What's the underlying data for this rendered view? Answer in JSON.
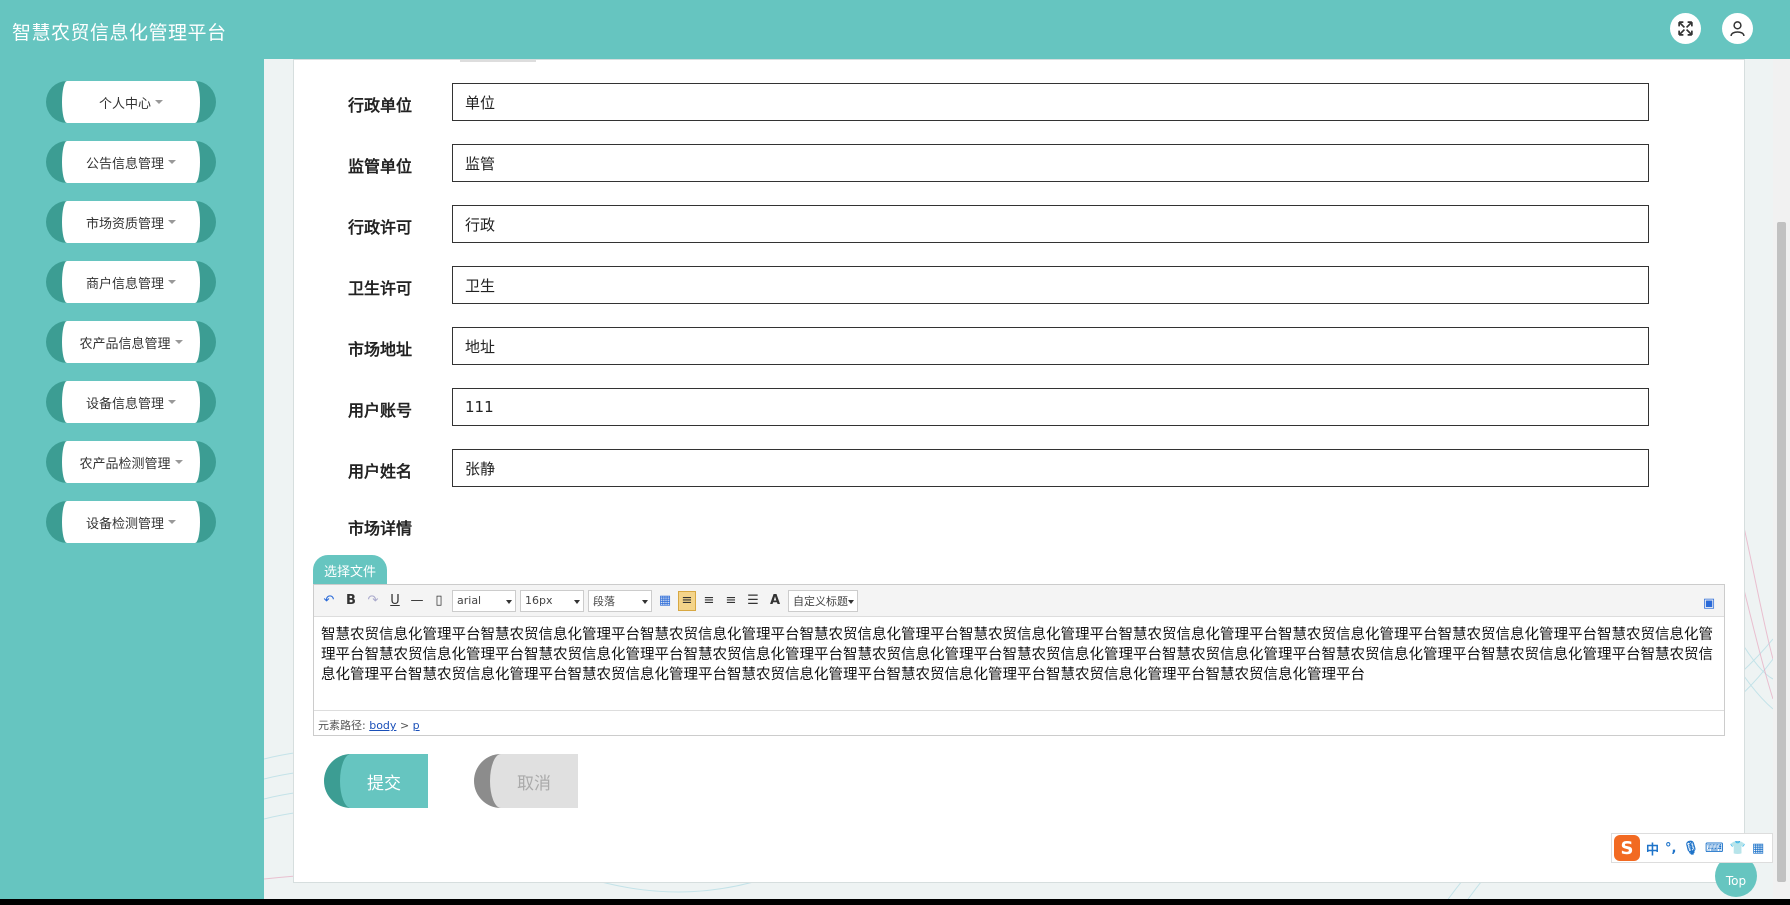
{
  "app": {
    "title": "智慧农贸信息化管理平台"
  },
  "header": {
    "fullscreen_icon": "expand-icon",
    "user_icon": "user-icon"
  },
  "sidebar": {
    "items": [
      {
        "label": "个人中心"
      },
      {
        "label": "公告信息管理"
      },
      {
        "label": "市场资质管理"
      },
      {
        "label": "商户信息管理"
      },
      {
        "label": "农产品信息管理"
      },
      {
        "label": "设备信息管理"
      },
      {
        "label": "农产品检测管理"
      },
      {
        "label": "设备检测管理"
      }
    ]
  },
  "form": {
    "fields": [
      {
        "label": "行政单位",
        "value": "单位"
      },
      {
        "label": "监管单位",
        "value": "监管"
      },
      {
        "label": "行政许可",
        "value": "行政"
      },
      {
        "label": "卫生许可",
        "value": "卫生"
      },
      {
        "label": "市场地址",
        "value": "地址"
      },
      {
        "label": "用户账号",
        "value": "111"
      },
      {
        "label": "用户姓名",
        "value": "张静"
      }
    ],
    "detail_label": "市场详情",
    "upload_label": "选择文件",
    "editor": {
      "font_family": "arial",
      "font_size": "16px",
      "paragraph": "段落",
      "custom_title": "自定义标题",
      "content": "智慧农贸信息化管理平台智慧农贸信息化管理平台智慧农贸信息化管理平台智慧农贸信息化管理平台智慧农贸信息化管理平台智慧农贸信息化管理平台智慧农贸信息化管理平台智慧农贸信息化管理平台智慧农贸信息化管理平台智慧农贸信息化管理平台智慧农贸信息化管理平台智慧农贸信息化管理平台智慧农贸信息化管理平台智慧农贸信息化管理平台智慧农贸信息化管理平台智慧农贸信息化管理平台智慧农贸信息化管理平台智慧农贸信息化管理平台智慧农贸信息化管理平台智慧农贸信息化管理平台智慧农贸信息化管理平台智慧农贸信息化管理平台智慧农贸信息化管理平台智慧农贸信息化管理平台",
      "path_label": "元素路径:",
      "path_body": "body",
      "path_sep": ">",
      "path_p": "p"
    },
    "submit_label": "提交",
    "cancel_label": "取消"
  },
  "top_button": "Top",
  "ime": {
    "logo": "S",
    "lang": "中",
    "punct": "°,",
    "icons": [
      "mic-icon",
      "keyboard-icon",
      "shirt-icon",
      "grid-icon"
    ]
  },
  "colors": {
    "primary": "#66c5c0",
    "primary_dark": "#3c9d93"
  }
}
